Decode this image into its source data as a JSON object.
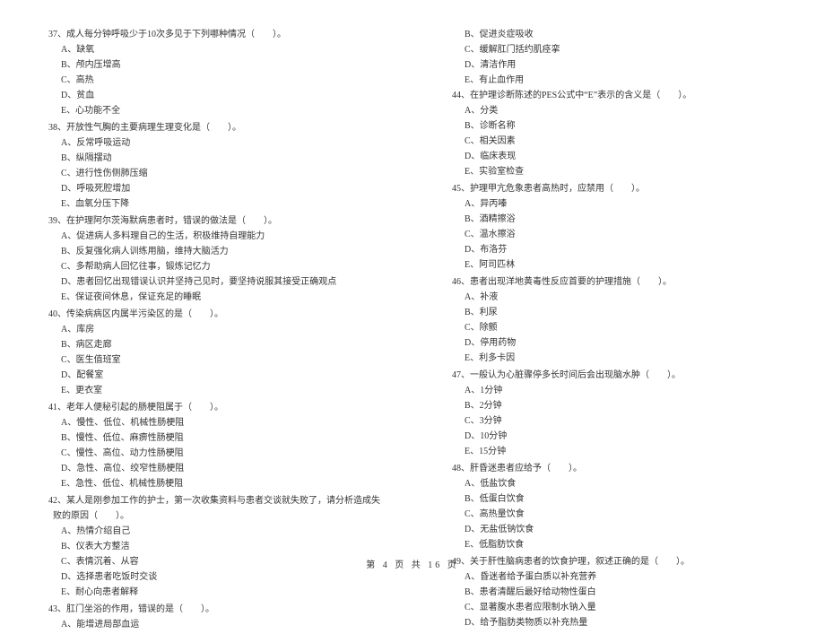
{
  "left": [
    {
      "n": "37",
      "stem": "成人每分钟呼吸少于10次多见于下列哪种情况（　　）。",
      "opts": [
        "A、缺氧",
        "B、颅内压增高",
        "C、高热",
        "D、贫血",
        "E、心功能不全"
      ]
    },
    {
      "n": "38",
      "stem": "开放性气胸的主要病理生理变化是（　　）。",
      "opts": [
        "A、反常呼吸运动",
        "B、纵隔摆动",
        "C、进行性伤侧肺压缩",
        "D、呼吸死腔增加",
        "E、血氧分压下降"
      ]
    },
    {
      "n": "39",
      "stem": "在护理阿尔茨海默病患者时，错误的做法是（　　）。",
      "opts": [
        "A、促进病人多料理自己的生活，积极维持自理能力",
        "B、反复强化病人训练用脑，维持大脑活力",
        "C、多帮助病人回忆往事，锻炼记忆力",
        "D、患者回忆出现错误认识并坚持己见时，要坚持说服其接受正确观点",
        "E、保证夜间休息，保证充足的睡眠"
      ]
    },
    {
      "n": "40",
      "stem": "传染病病区内属半污染区的是（　　）。",
      "opts": [
        "A、库房",
        "B、病区走廊",
        "C、医生值班室",
        "D、配餐室",
        "E、更衣室"
      ]
    },
    {
      "n": "41",
      "stem": "老年人便秘引起的肠梗阻属于（　　）。",
      "opts": [
        "A、慢性、低位、机械性肠梗阻",
        "B、慢性、低位、麻痹性肠梗阻",
        "C、慢性、高位、动力性肠梗阻",
        "D、急性、高位、绞窄性肠梗阻",
        "E、急性、低位、机械性肠梗阻"
      ]
    },
    {
      "n": "42",
      "stem": "某人是刚参加工作的护士，第一次收集资料与患者交谈就失败了，请分析造成失败的原因（　　）。",
      "opts": [
        "A、热情介绍自己",
        "B、仪表大方整洁",
        "C、表情沉着、从容",
        "D、选择患者吃饭时交谈",
        "E、耐心向患者解释"
      ]
    },
    {
      "n": "43",
      "stem": "肛门坐浴的作用，错误的是（　　）。",
      "opts": [
        "A、能增进局部血运"
      ]
    }
  ],
  "right_head": [
    "B、促进炎症吸收",
    "C、缓解肛门括约肌痉挛",
    "D、清洁作用",
    "E、有止血作用"
  ],
  "right": [
    {
      "n": "44",
      "stem": "在护理诊断陈述的PES公式中“E”表示的含义是（　　）。",
      "opts": [
        "A、分类",
        "B、诊断名称",
        "C、相关因素",
        "D、临床表现",
        "E、实验室检查"
      ]
    },
    {
      "n": "45",
      "stem": "护理甲亢危象患者高热时，应禁用（　　）。",
      "opts": [
        "A、异丙嗪",
        "B、酒精擦浴",
        "C、温水擦浴",
        "D、布洛芬",
        "E、阿司匹林"
      ]
    },
    {
      "n": "46",
      "stem": "患者出现洋地黄毒性反应首要的护理措施（　　）。",
      "opts": [
        "A、补液",
        "B、利尿",
        "C、除颤",
        "D、停用药物",
        "E、利多卡因"
      ]
    },
    {
      "n": "47",
      "stem": "一般认为心脏骤停多长时间后会出现脑水肿（　　）。",
      "opts": [
        "A、1分钟",
        "B、2分钟",
        "C、3分钟",
        "D、10分钟",
        "E、15分钟"
      ]
    },
    {
      "n": "48",
      "stem": "肝昏迷患者应给予（　　）。",
      "opts": [
        "A、低盐饮食",
        "B、低蛋白饮食",
        "C、高热量饮食",
        "D、无盐低钠饮食",
        "E、低脂肪饮食"
      ]
    },
    {
      "n": "49",
      "stem": "关于肝性脑病患者的饮食护理，叙述正确的是（　　）。",
      "opts": [
        "A、昏迷者给予蛋白质以补充营养",
        "B、患者清醒后最好给动物性蛋白",
        "C、显著腹水患者应限制水钠入量",
        "D、给予脂肪类物质以补充热量"
      ]
    }
  ],
  "pager": "第 4 页 共 16 页"
}
